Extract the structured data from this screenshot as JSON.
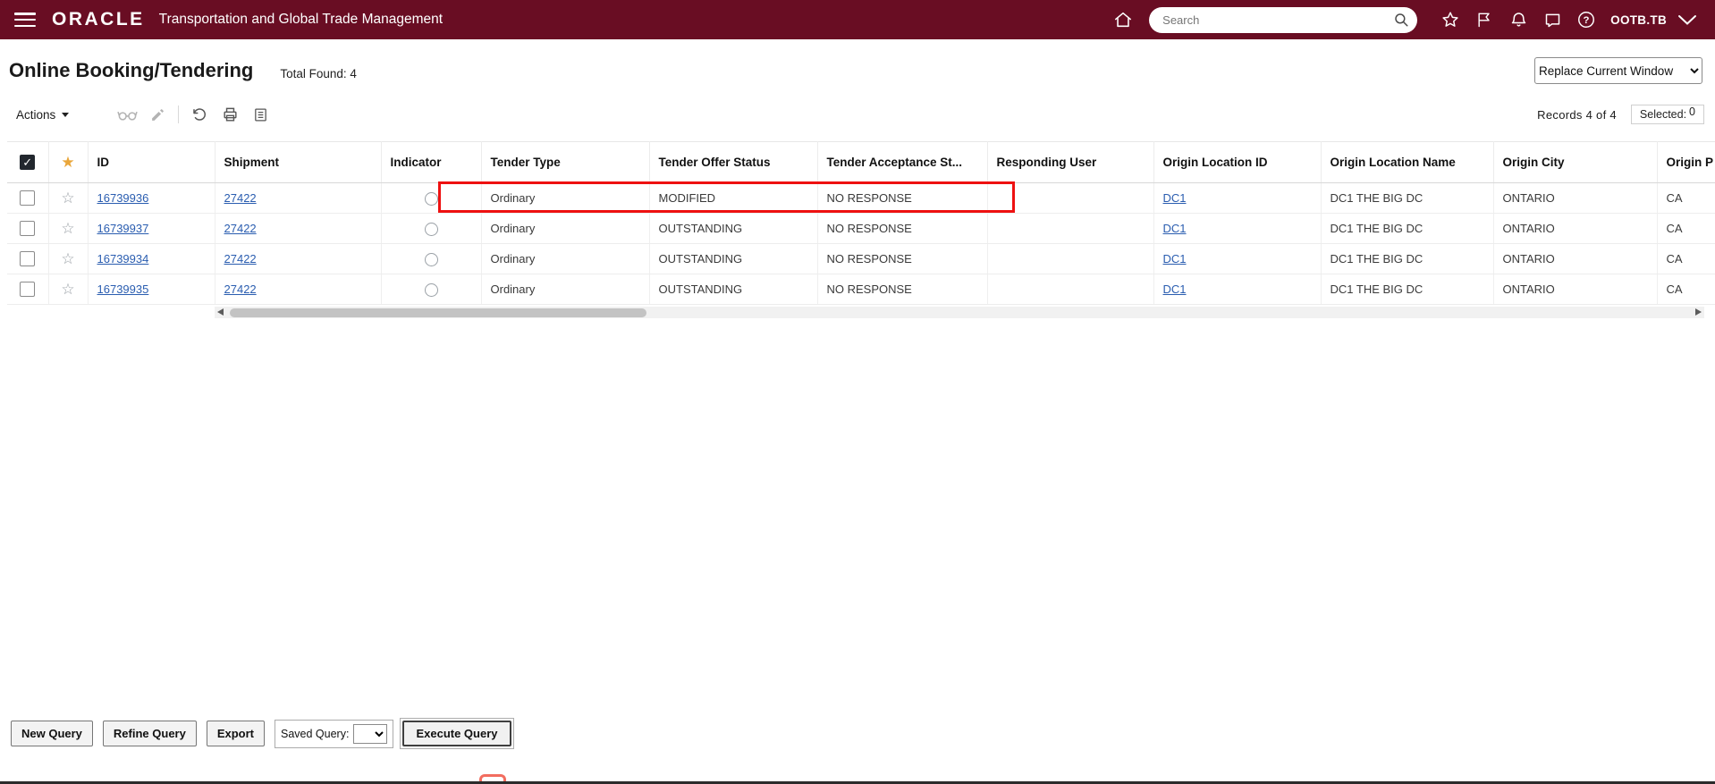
{
  "topbar": {
    "brand": "ORACLE",
    "app_title": "Transportation and Global Trade Management",
    "search_placeholder": "Search",
    "username": "OOTB.TB"
  },
  "page": {
    "title": "Online Booking/Tendering",
    "total_found": "Total Found: 4",
    "window_mode": "Replace Current Window"
  },
  "toolbar": {
    "actions": "Actions",
    "records": "Records  4  of  4",
    "selected_label": "Selected:",
    "selected_count": "0"
  },
  "table": {
    "columns": [
      "ID",
      "Shipment",
      "Indicator",
      "Tender Type",
      "Tender Offer Status",
      "Tender Acceptance St...",
      "Responding User",
      "Origin Location ID",
      "Origin Location Name",
      "Origin City",
      "Origin P"
    ],
    "rows": [
      {
        "id": "16739936",
        "shipment": "27422",
        "tender_type": "Ordinary",
        "tender_offer_status": "MODIFIED",
        "tender_acceptance_status": "NO RESPONSE",
        "responding_user": "",
        "origin_location_id": "DC1",
        "origin_location_name": "DC1 THE BIG DC",
        "origin_city": "ONTARIO",
        "origin_province": "CA"
      },
      {
        "id": "16739937",
        "shipment": "27422",
        "tender_type": "Ordinary",
        "tender_offer_status": "OUTSTANDING",
        "tender_acceptance_status": "NO RESPONSE",
        "responding_user": "",
        "origin_location_id": "DC1",
        "origin_location_name": "DC1 THE BIG DC",
        "origin_city": "ONTARIO",
        "origin_province": "CA"
      },
      {
        "id": "16739934",
        "shipment": "27422",
        "tender_type": "Ordinary",
        "tender_offer_status": "OUTSTANDING",
        "tender_acceptance_status": "NO RESPONSE",
        "responding_user": "",
        "origin_location_id": "DC1",
        "origin_location_name": "DC1 THE BIG DC",
        "origin_city": "ONTARIO",
        "origin_province": "CA"
      },
      {
        "id": "16739935",
        "shipment": "27422",
        "tender_type": "Ordinary",
        "tender_offer_status": "OUTSTANDING",
        "tender_acceptance_status": "NO RESPONSE",
        "responding_user": "",
        "origin_location_id": "DC1",
        "origin_location_name": "DC1 THE BIG DC",
        "origin_city": "ONTARIO",
        "origin_province": "CA"
      }
    ]
  },
  "footer": {
    "new_query": "New Query",
    "refine_query": "Refine Query",
    "export": "Export",
    "saved_query_label": "Saved Query:",
    "execute_query": "Execute Query"
  },
  "icons": {
    "header_star": "★",
    "row_star": "☆",
    "check": "✓"
  },
  "colors": {
    "topbar_bg": "#690d23",
    "link": "#2a5db0",
    "highlight_red": "#ee1111",
    "star_gold": "#e9a63a"
  }
}
